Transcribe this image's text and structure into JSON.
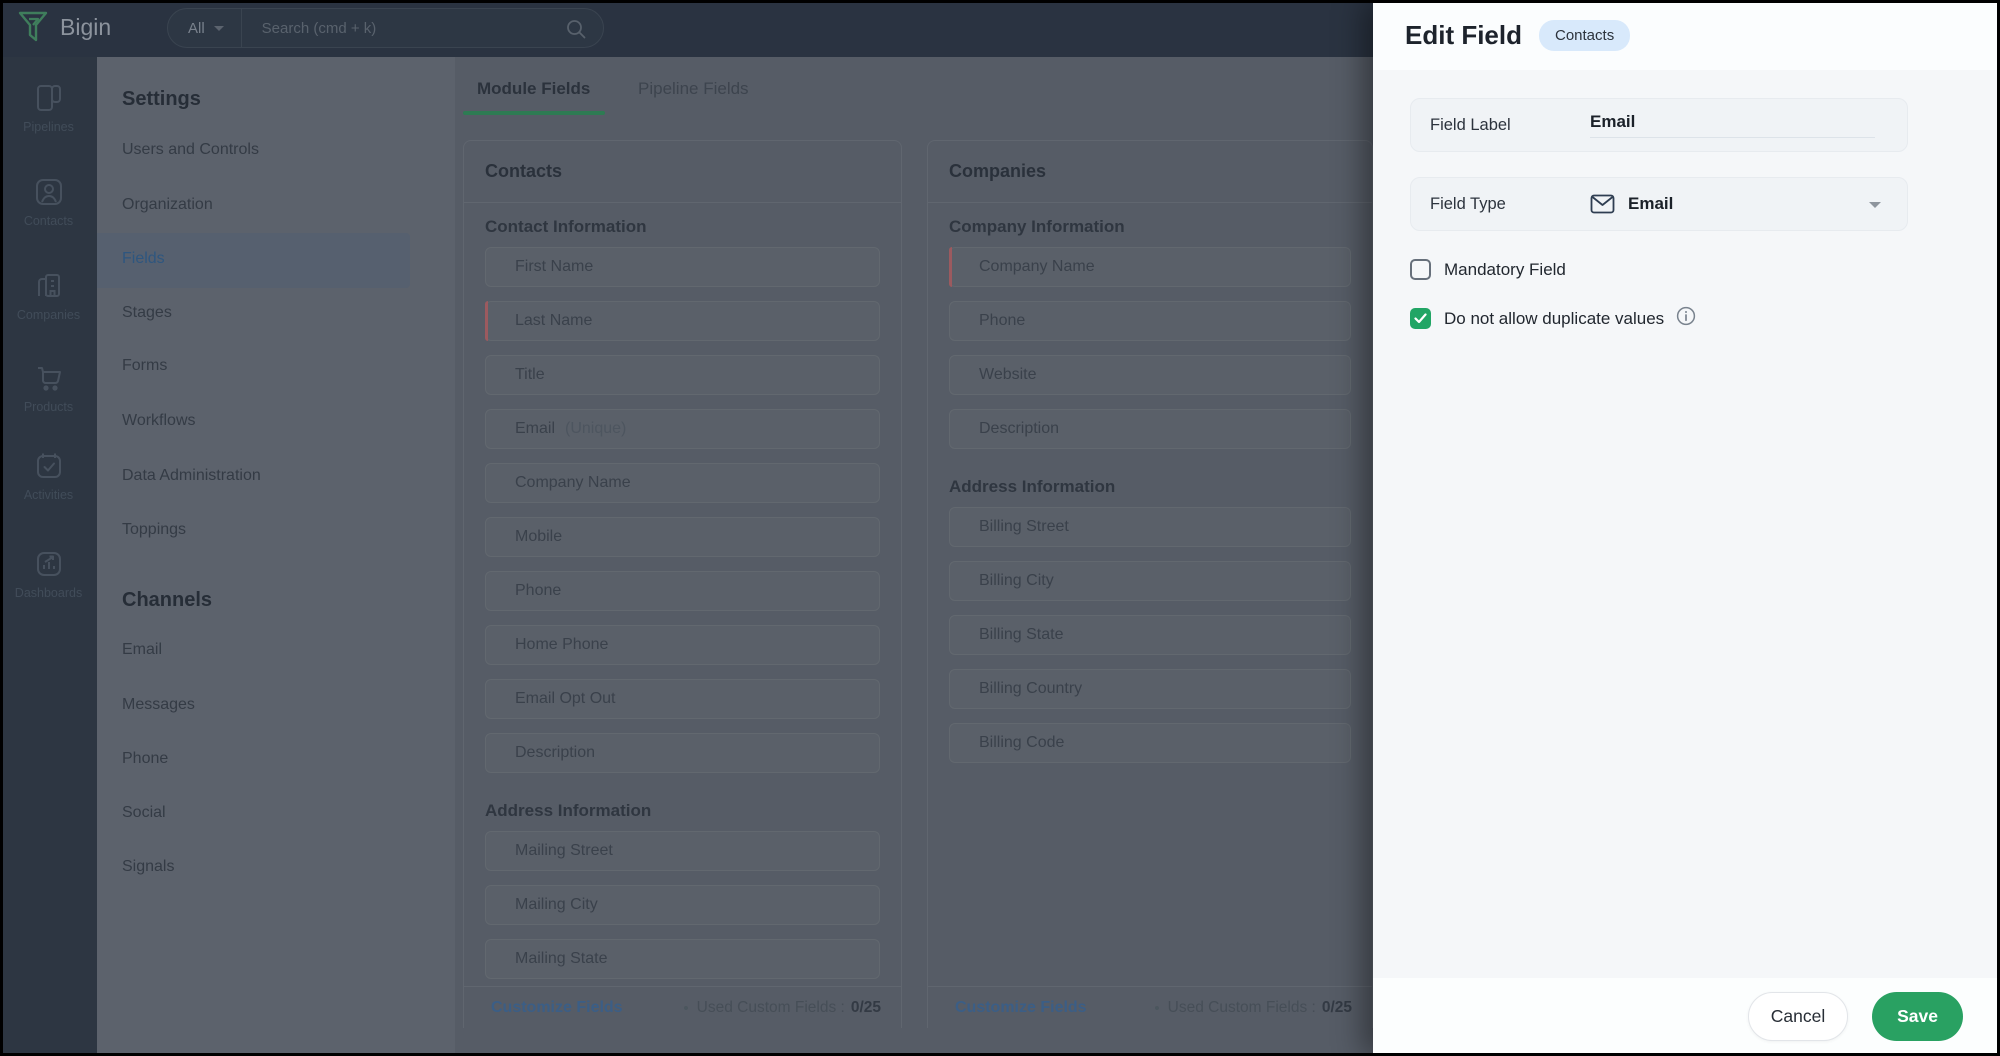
{
  "topbar": {
    "brand": "Bigin",
    "search_scope": "All",
    "search_placeholder": "Search (cmd + k)"
  },
  "rail": {
    "items": [
      {
        "label": "Pipelines"
      },
      {
        "label": "Contacts"
      },
      {
        "label": "Companies"
      },
      {
        "label": "Products"
      },
      {
        "label": "Activities"
      },
      {
        "label": "Dashboards"
      }
    ]
  },
  "settings_nav": {
    "title": "Settings",
    "items": [
      {
        "label": "Users and Controls"
      },
      {
        "label": "Organization"
      },
      {
        "label": "Fields"
      },
      {
        "label": "Stages"
      },
      {
        "label": "Forms"
      },
      {
        "label": "Workflows"
      },
      {
        "label": "Data Administration"
      },
      {
        "label": "Toppings"
      }
    ],
    "channels_title": "Channels",
    "channel_items": [
      {
        "label": "Email"
      },
      {
        "label": "Messages"
      },
      {
        "label": "Phone"
      },
      {
        "label": "Social"
      },
      {
        "label": "Signals"
      }
    ]
  },
  "tabs": {
    "module": "Module Fields",
    "pipeline": "Pipeline Fields"
  },
  "contacts_column": {
    "title": "Contacts",
    "sections": [
      {
        "title": "Contact Information",
        "fields": [
          {
            "label": "First Name"
          },
          {
            "label": "Last Name",
            "mandatory": true
          },
          {
            "label": "Title"
          },
          {
            "label": "Email",
            "suffix": "(Unique)"
          },
          {
            "label": "Company Name"
          },
          {
            "label": "Mobile"
          },
          {
            "label": "Phone"
          },
          {
            "label": "Home Phone"
          },
          {
            "label": "Email Opt Out"
          },
          {
            "label": "Description"
          }
        ]
      },
      {
        "title": "Address Information",
        "fields": [
          {
            "label": "Mailing Street"
          },
          {
            "label": "Mailing City"
          },
          {
            "label": "Mailing State"
          }
        ]
      }
    ],
    "footer": {
      "link": "Customize Fields",
      "dot": "•",
      "used_label": "Used Custom Fields :",
      "used_value": "0/25"
    }
  },
  "companies_column": {
    "title": "Companies",
    "sections": [
      {
        "title": "Company Information",
        "fields": [
          {
            "label": "Company Name",
            "mandatory": true
          },
          {
            "label": "Phone"
          },
          {
            "label": "Website"
          },
          {
            "label": "Description"
          }
        ]
      },
      {
        "title": "Address Information",
        "fields": [
          {
            "label": "Billing Street"
          },
          {
            "label": "Billing City"
          },
          {
            "label": "Billing State"
          },
          {
            "label": "Billing Country"
          },
          {
            "label": "Billing Code"
          }
        ]
      }
    ],
    "footer": {
      "link": "Customize Fields",
      "dot": "•",
      "used_label": "Used Custom Fields :",
      "used_value": "0/25"
    }
  },
  "edit_panel": {
    "title": "Edit Field",
    "module_badge": "Contacts",
    "field_label_row": {
      "label": "Field Label",
      "value": "Email"
    },
    "field_type_row": {
      "label": "Field Type",
      "value": "Email",
      "icon": "email-icon"
    },
    "checkboxes": [
      {
        "label": "Mandatory Field",
        "checked": false
      },
      {
        "label": "Do not allow duplicate values",
        "checked": true,
        "info_icon": true
      }
    ],
    "footer": {
      "cancel": "Cancel",
      "save": "Save"
    }
  },
  "colors": {
    "accent_green": "#29a162",
    "checkbox_green": "#21a565",
    "tab_underline": "#2e7b53",
    "mandatory_red": "#9c5a5f",
    "badge_blue": "#d8e9fb",
    "link_blue": "#3b5e86"
  }
}
